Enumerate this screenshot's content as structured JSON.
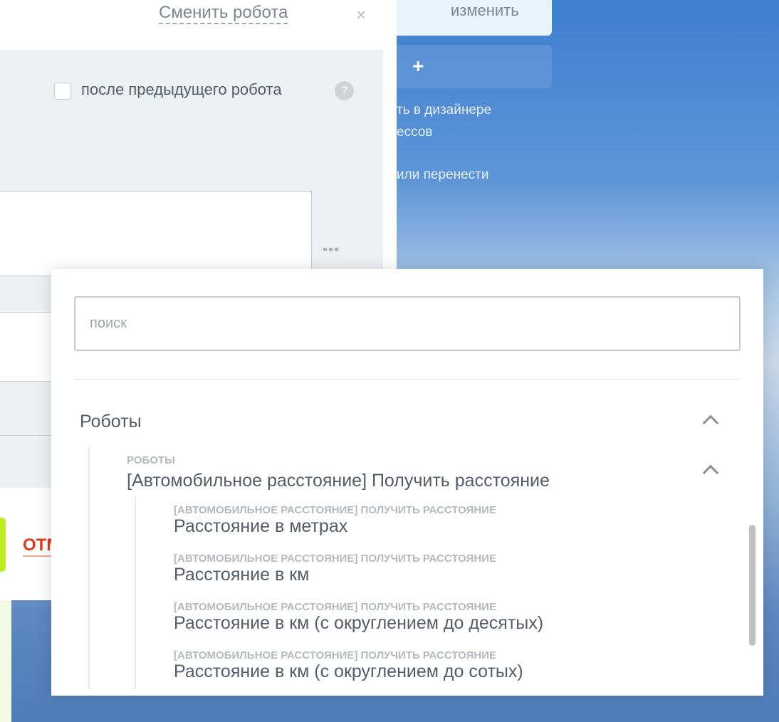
{
  "robot_panel": {
    "change_robot": "Сменить робота",
    "close": "×",
    "after_previous_label": "после предыдущего робота",
    "help": "?",
    "more": "•••",
    "cancel": "ОТМ"
  },
  "background_panel": {
    "change_button": "изменить",
    "add_button": "+",
    "text_line1": "ть в дизайнере",
    "text_line2": "ессов",
    "text_line3": "или перенести"
  },
  "popup": {
    "search_placeholder": "поиск",
    "section": "Роботы",
    "group": {
      "caption": "РОБОТЫ",
      "title": "[Автомобильное расстояние] Получить расстояние"
    },
    "items": [
      {
        "caption": "[АВТОМОБИЛЬНОЕ РАССТОЯНИЕ] ПОЛУЧИТЬ РАССТОЯНИЕ",
        "title": "Расстояние в метрах"
      },
      {
        "caption": "[АВТОМОБИЛЬНОЕ РАССТОЯНИЕ] ПОЛУЧИТЬ РАССТОЯНИЕ",
        "title": "Расстояние в км"
      },
      {
        "caption": "[АВТОМОБИЛЬНОЕ РАССТОЯНИЕ] ПОЛУЧИТЬ РАССТОЯНИЕ",
        "title": "Расстояние в км (с округлением до десятых)"
      },
      {
        "caption": "[АВТОМОБИЛЬНОЕ РАССТОЯНИЕ] ПОЛУЧИТЬ РАССТОЯНИЕ",
        "title": "Расстояние в км (с округлением до сотых)"
      }
    ]
  }
}
